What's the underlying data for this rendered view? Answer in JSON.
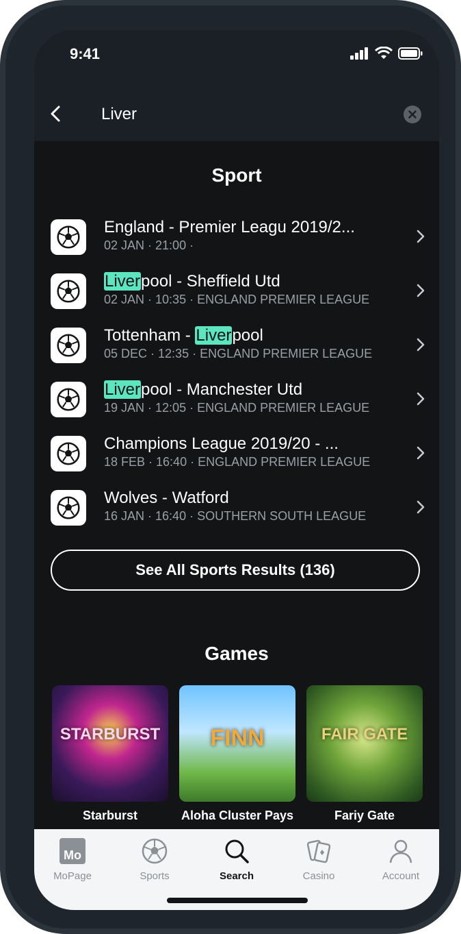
{
  "status_bar": {
    "time": "9:41"
  },
  "search": {
    "value": "Liver"
  },
  "sport": {
    "title": "Sport",
    "results": [
      {
        "title_parts": [
          "England - Premier Leagu 2019/2...",
          "",
          ""
        ],
        "date": "02 JAN",
        "time": "21:00",
        "league": ""
      },
      {
        "title_parts": [
          "",
          "Liver",
          "pool - Sheffield Utd"
        ],
        "date": "02 JAN",
        "time": "10:35",
        "league": "ENGLAND PREMIER LEAGUE"
      },
      {
        "title_parts": [
          "Tottenham - ",
          "Liver",
          "pool"
        ],
        "date": "05 DEC",
        "time": "12:35",
        "league": "ENGLAND PREMIER LEAGUE"
      },
      {
        "title_parts": [
          "",
          "Liver",
          "pool - Manchester Utd"
        ],
        "date": "19 JAN",
        "time": "12:05",
        "league": "ENGLAND PREMIER LEAGUE"
      },
      {
        "title_parts": [
          "Champions League 2019/20 - ...",
          "",
          ""
        ],
        "date": "18 FEB",
        "time": "16:40",
        "league": "ENGLAND PREMIER LEAGUE"
      },
      {
        "title_parts": [
          "Wolves - Watford",
          "",
          ""
        ],
        "date": "16 JAN",
        "time": "16:40",
        "league": "SOUTHERN SOUTH LEAGUE"
      }
    ],
    "see_all_label": "See All Sports Results (136)"
  },
  "games": {
    "title": "Games",
    "items": [
      {
        "label": "Starburst",
        "logo": "STARBURST"
      },
      {
        "label": "Aloha Cluster Pays",
        "logo": "FINN"
      },
      {
        "label": "Fariy Gate",
        "logo": "FAIR GATE"
      }
    ]
  },
  "nav": {
    "items": [
      {
        "label": "MoPage",
        "icon": "mopage-icon"
      },
      {
        "label": "Sports",
        "icon": "soccer-ball-icon"
      },
      {
        "label": "Search",
        "icon": "search-icon"
      },
      {
        "label": "Casino",
        "icon": "cards-icon"
      },
      {
        "label": "Account",
        "icon": "user-icon"
      }
    ],
    "mopage_badge": "Mo"
  },
  "colors": {
    "highlight": "#5ce6c0",
    "background": "#121416",
    "nav_bg": "#f4f5f6"
  }
}
